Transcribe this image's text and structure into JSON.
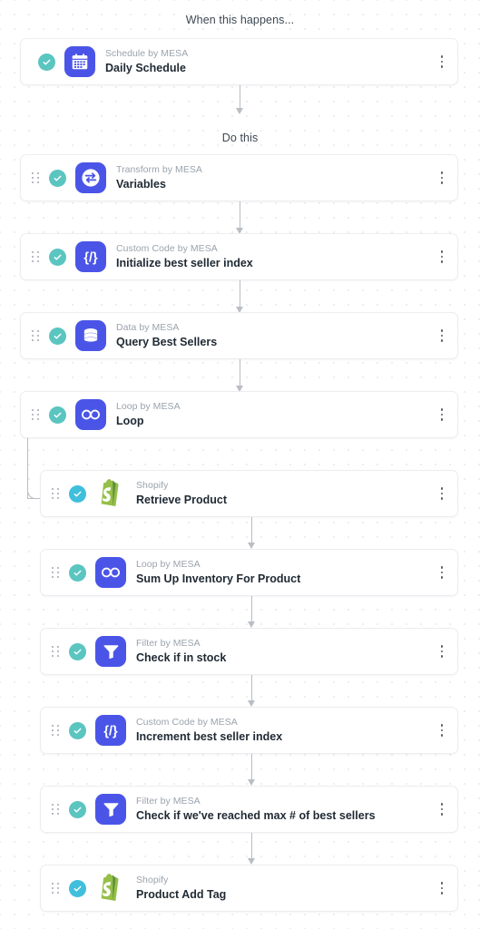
{
  "headings": {
    "trigger": "When this happens...",
    "actions": "Do this"
  },
  "colors": {
    "icon_blue": "#4a55e8",
    "check_teal": "#5bc5c0",
    "check_cyan": "#3fbfdc",
    "shopify_green": "#95bf47",
    "connector_gray": "#b9bec5",
    "app_label_gray": "#9aa3ad",
    "title_dark": "#1f2933"
  },
  "steps": [
    {
      "app": "Schedule by MESA",
      "title": "Daily Schedule",
      "icon": "calendar-icon",
      "icon_style": "blue",
      "check": "check-circle-icon",
      "check_color": "teal",
      "has_drag_handle": false,
      "indent": 0,
      "menu": "more-options-icon"
    },
    {
      "app": "Transform by MESA",
      "title": "Variables",
      "icon": "transform-swap-icon",
      "icon_style": "blue",
      "check": "check-circle-icon",
      "check_color": "teal",
      "has_drag_handle": true,
      "indent": 0,
      "menu": "more-options-icon"
    },
    {
      "app": "Custom Code by MESA",
      "title": "Initialize best seller index",
      "icon": "code-braces-icon",
      "icon_style": "blue",
      "check": "check-circle-icon",
      "check_color": "teal",
      "has_drag_handle": true,
      "indent": 0,
      "menu": "more-options-icon"
    },
    {
      "app": "Data by MESA",
      "title": "Query Best Sellers",
      "icon": "database-icon",
      "icon_style": "blue",
      "check": "check-circle-icon",
      "check_color": "teal",
      "has_drag_handle": true,
      "indent": 0,
      "menu": "more-options-icon"
    },
    {
      "app": "Loop by MESA",
      "title": "Loop",
      "icon": "infinity-loop-icon",
      "icon_style": "blue",
      "check": "check-circle-icon",
      "check_color": "teal",
      "has_drag_handle": true,
      "indent": 0,
      "menu": "more-options-icon"
    },
    {
      "app": "Shopify",
      "title": "Retrieve Product",
      "icon": "shopify-bag-icon",
      "icon_style": "plain",
      "check": "check-circle-icon",
      "check_color": "cyan",
      "has_drag_handle": true,
      "indent": 1,
      "menu": "more-options-icon"
    },
    {
      "app": "Loop by MESA",
      "title": "Sum Up Inventory For Product",
      "icon": "infinity-loop-icon",
      "icon_style": "blue",
      "check": "check-circle-icon",
      "check_color": "teal",
      "has_drag_handle": true,
      "indent": 1,
      "menu": "more-options-icon"
    },
    {
      "app": "Filter by MESA",
      "title": "Check if in stock",
      "icon": "filter-funnel-icon",
      "icon_style": "blue",
      "check": "check-circle-icon",
      "check_color": "teal",
      "has_drag_handle": true,
      "indent": 1,
      "menu": "more-options-icon"
    },
    {
      "app": "Custom Code by MESA",
      "title": "Increment best seller index",
      "icon": "code-braces-icon",
      "icon_style": "blue",
      "check": "check-circle-icon",
      "check_color": "teal",
      "has_drag_handle": true,
      "indent": 1,
      "menu": "more-options-icon"
    },
    {
      "app": "Filter by MESA",
      "title": "Check if we've reached max # of best sellers",
      "icon": "filter-funnel-icon",
      "icon_style": "blue",
      "check": "check-circle-icon",
      "check_color": "teal",
      "has_drag_handle": true,
      "indent": 1,
      "menu": "more-options-icon"
    },
    {
      "app": "Shopify",
      "title": "Product Add Tag",
      "icon": "shopify-bag-icon",
      "icon_style": "plain",
      "check": "check-circle-icon",
      "check_color": "cyan",
      "has_drag_handle": true,
      "indent": 1,
      "menu": "more-options-icon"
    }
  ]
}
